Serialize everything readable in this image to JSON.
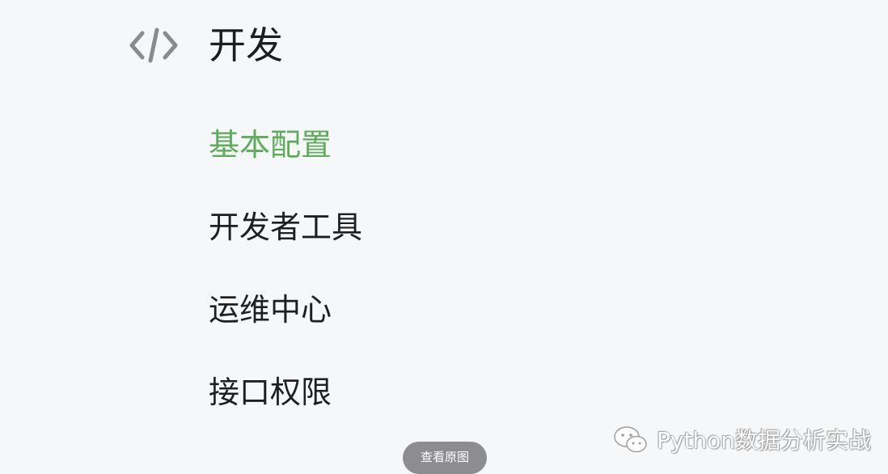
{
  "section": {
    "icon": "code-icon",
    "title": "开发"
  },
  "nav": {
    "items": [
      {
        "label": "基本配置",
        "active": true
      },
      {
        "label": "开发者工具",
        "active": false
      },
      {
        "label": "运维中心",
        "active": false
      },
      {
        "label": "接口权限",
        "active": false
      }
    ],
    "active_color": "#5dad5a"
  },
  "overlay": {
    "view_original_label": "查看原图"
  },
  "watermark": {
    "icon": "wechat-icon",
    "text": "Python数据分析实战"
  }
}
